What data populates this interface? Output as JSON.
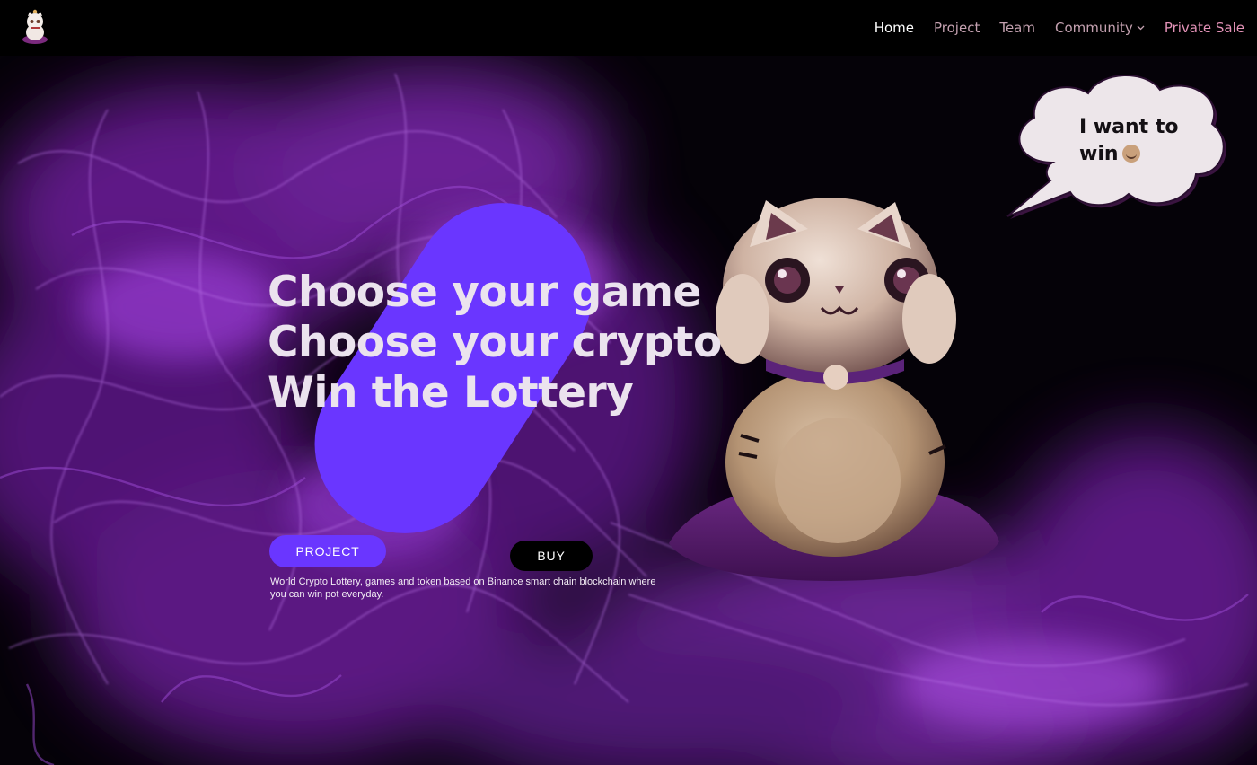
{
  "nav": {
    "items": [
      {
        "label": "Home",
        "active": true
      },
      {
        "label": "Project"
      },
      {
        "label": "Team"
      },
      {
        "label": "Community",
        "dropdown": true
      },
      {
        "label": "Private Sale"
      }
    ]
  },
  "hero": {
    "headline": [
      "Choose your game",
      "Choose your crypto",
      "Win the Lottery"
    ],
    "project_button": "PROJECT",
    "buy_button": "BUY",
    "description": "World Crypto Lottery, games and token based on Binance smart chain blockchain where you can win pot everyday."
  },
  "bubble": {
    "line1": "I want to",
    "line2": "win"
  },
  "colors": {
    "accent": "#6a36ff",
    "background": "#040206",
    "smoke": "#8a2fc4",
    "nav_text": "#c4a1b0",
    "nav_sale": "#e493b8"
  }
}
